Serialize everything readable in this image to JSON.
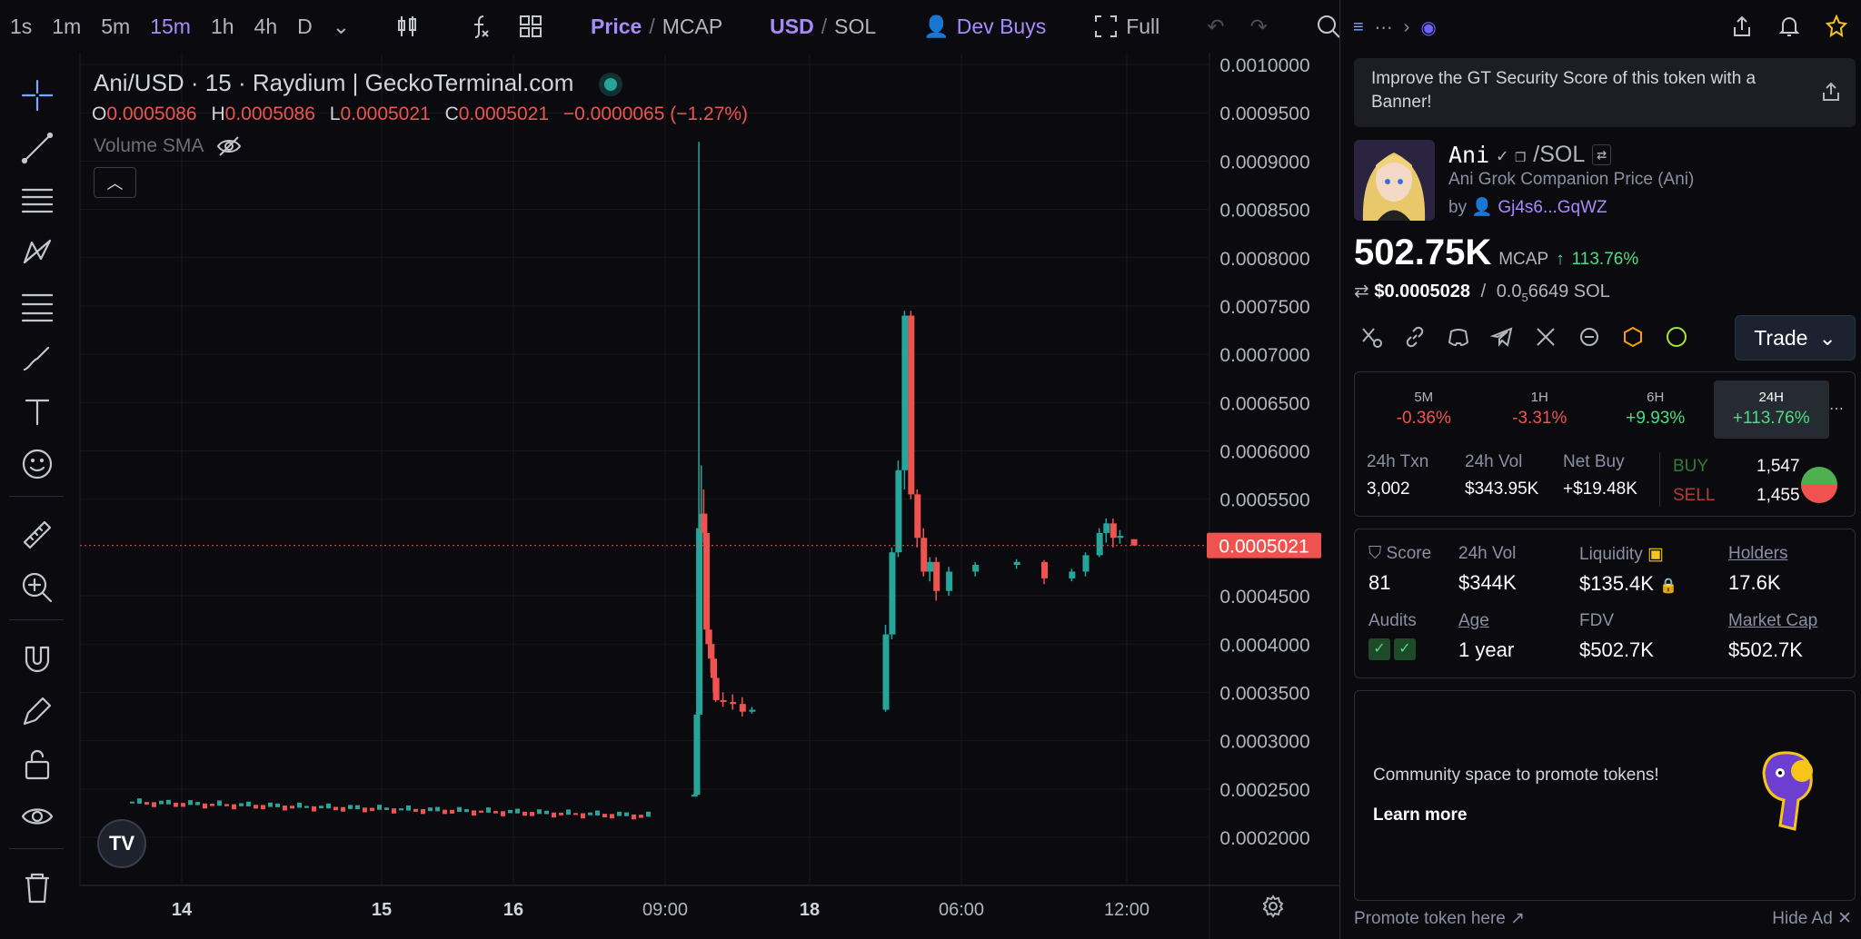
{
  "toolbar": {
    "timeframes": [
      "1s",
      "1m",
      "5m",
      "15m",
      "1h",
      "4h",
      "D"
    ],
    "active_timeframe": "15m",
    "price_label": "Price",
    "mcap_label": "MCAP",
    "usd_label": "USD",
    "sol_label": "SOL",
    "dev_buys_label": "Dev Buys",
    "full_label": "Full",
    "divider": "/"
  },
  "legend": {
    "title": "Ani/USD · 15 · Raydium | GeckoTerminal.com",
    "o_key": "O",
    "o_val": "0.0005086",
    "h_key": "H",
    "h_val": "0.0005086",
    "l_key": "L",
    "l_val": "0.0005021",
    "c_key": "C",
    "c_val": "0.0005021",
    "change": "−0.0000065 (−1.27%)",
    "volume_sma": "Volume SMA"
  },
  "chart_data": {
    "type": "candlestick",
    "title": "Ani/USD · 15 · Raydium | GeckoTerminal.com",
    "y_ticks": [
      "0.0010000",
      "0.0009500",
      "0.0009000",
      "0.0008500",
      "0.0008000",
      "0.0007500",
      "0.0007000",
      "0.0006500",
      "0.0006000",
      "0.0005500",
      "0.0005021",
      "0.0004500",
      "0.0004000",
      "0.0003500",
      "0.0003000",
      "0.0002500",
      "0.0002000"
    ],
    "x_ticks": [
      "14",
      "15",
      "16",
      "09:00",
      "18",
      "06:00",
      "12:00"
    ],
    "ylim": [
      0.00016,
      0.001
    ],
    "last_price": 0.0005021,
    "last_price_label": "0.0005021",
    "baseline_segments": [
      {
        "from": "13 18:00",
        "to": "17 08:00",
        "price_start": 0.000236,
        "price_end": 0.000222
      }
    ],
    "candles": [
      {
        "t": "17 12:00",
        "o": 0.000243,
        "h": 0.000245,
        "l": 0.000242,
        "c": 0.000244
      },
      {
        "t": "17 12:15",
        "o": 0.000244,
        "h": 0.00033,
        "l": 0.000243,
        "c": 0.000327
      },
      {
        "t": "17 12:30",
        "o": 0.000327,
        "h": 0.00092,
        "l": 0.00032,
        "c": 0.00052
      },
      {
        "t": "17 12:45",
        "o": 0.00052,
        "h": 0.000585,
        "l": 0.00048,
        "c": 0.000535
      },
      {
        "t": "17 13:00",
        "o": 0.000535,
        "h": 0.00056,
        "l": 0.000505,
        "c": 0.000515
      },
      {
        "t": "17 13:15",
        "o": 0.000515,
        "h": 0.00053,
        "l": 0.0004,
        "c": 0.000415
      },
      {
        "t": "17 13:30",
        "o": 0.000415,
        "h": 0.000425,
        "l": 0.000385,
        "c": 0.0004
      },
      {
        "t": "17 13:45",
        "o": 0.0004,
        "h": 0.000405,
        "l": 0.00037,
        "c": 0.000385
      },
      {
        "t": "17 14:00",
        "o": 0.000385,
        "h": 0.000395,
        "l": 0.00035,
        "c": 0.000365
      },
      {
        "t": "17 14:15",
        "o": 0.000365,
        "h": 0.000375,
        "l": 0.00034,
        "c": 0.000342
      },
      {
        "t": "17 15:00",
        "o": 0.000342,
        "h": 0.00035,
        "l": 0.000335,
        "c": 0.00034
      },
      {
        "t": "17 16:00",
        "o": 0.00034,
        "h": 0.000348,
        "l": 0.000332,
        "c": 0.000338
      },
      {
        "t": "17 17:00",
        "o": 0.000338,
        "h": 0.000345,
        "l": 0.000325,
        "c": 0.00033
      },
      {
        "t": "17 18:00",
        "o": 0.00033,
        "h": 0.000335,
        "l": 0.000328,
        "c": 0.000332
      },
      {
        "t": "18 03:00",
        "o": 0.000332,
        "h": 0.00042,
        "l": 0.00033,
        "c": 0.00041
      },
      {
        "t": "18 03:15",
        "o": 0.00041,
        "h": 0.0005,
        "l": 0.000405,
        "c": 0.000495
      },
      {
        "t": "18 03:30",
        "o": 0.000495,
        "h": 0.00059,
        "l": 0.00049,
        "c": 0.00058
      },
      {
        "t": "18 03:45",
        "o": 0.00058,
        "h": 0.000745,
        "l": 0.00056,
        "c": 0.00074
      },
      {
        "t": "18 04:00",
        "o": 0.00074,
        "h": 0.000745,
        "l": 0.00055,
        "c": 0.000555
      },
      {
        "t": "18 04:15",
        "o": 0.000555,
        "h": 0.00056,
        "l": 0.0005,
        "c": 0.00051
      },
      {
        "t": "18 04:30",
        "o": 0.00051,
        "h": 0.00052,
        "l": 0.00047,
        "c": 0.000475
      },
      {
        "t": "18 04:45",
        "o": 0.000475,
        "h": 0.00049,
        "l": 0.000465,
        "c": 0.000485
      },
      {
        "t": "18 05:00",
        "o": 0.000485,
        "h": 0.00049,
        "l": 0.000445,
        "c": 0.000455
      },
      {
        "t": "18 05:30",
        "o": 0.000455,
        "h": 0.00048,
        "l": 0.00045,
        "c": 0.000475
      },
      {
        "t": "18 06:30",
        "o": 0.000475,
        "h": 0.000485,
        "l": 0.00047,
        "c": 0.000482
      },
      {
        "t": "18 08:00",
        "o": 0.000482,
        "h": 0.000488,
        "l": 0.000478,
        "c": 0.000485
      },
      {
        "t": "18 09:00",
        "o": 0.000485,
        "h": 0.000487,
        "l": 0.000462,
        "c": 0.000468
      },
      {
        "t": "18 10:00",
        "o": 0.000468,
        "h": 0.000478,
        "l": 0.000465,
        "c": 0.000475
      },
      {
        "t": "18 10:30",
        "o": 0.000475,
        "h": 0.000495,
        "l": 0.00047,
        "c": 0.000492
      },
      {
        "t": "18 11:00",
        "o": 0.000492,
        "h": 0.00052,
        "l": 0.00049,
        "c": 0.000515
      },
      {
        "t": "18 11:15",
        "o": 0.000515,
        "h": 0.00053,
        "l": 0.000505,
        "c": 0.000525
      },
      {
        "t": "18 11:30",
        "o": 0.000525,
        "h": 0.00053,
        "l": 0.0005,
        "c": 0.00051
      },
      {
        "t": "18 11:45",
        "o": 0.00051,
        "h": 0.000518,
        "l": 0.000504,
        "c": 0.000512
      },
      {
        "t": "18 12:15",
        "o": 0.0005086,
        "h": 0.0005086,
        "l": 0.0005021,
        "c": 0.0005021
      }
    ],
    "up_color": "#26a69a",
    "down_color": "#ef5350",
    "grid": true
  },
  "panel": {
    "banner_text": "Improve the GT Security Score of this token with a Banner!",
    "token_symbol": "Ani",
    "pair_suffix": "/SOL",
    "token_full_name": "Ani Grok Companion Price (Ani)",
    "by_label": "by",
    "creator": "Gj4s6...GqWZ",
    "mcap_value": "502.75K",
    "mcap_label": "MCAP",
    "mcap_change": "113.76%",
    "price_usd": "$0.0005028",
    "price_sol_prefix": "0.0",
    "price_sol_sub": "5",
    "price_sol_rest": "6649 SOL",
    "price_sep": "/",
    "trade_label": "Trade",
    "periods": [
      {
        "label": "5M",
        "value": "-0.36%"
      },
      {
        "label": "1H",
        "value": "-3.31%"
      },
      {
        "label": "6H",
        "value": "+9.93%"
      },
      {
        "label": "24H",
        "value": "+113.76%"
      }
    ],
    "txn_label": "24h Txn",
    "txn_value": "3,002",
    "vol_label": "24h Vol",
    "vol_value": "$343.95K",
    "netbuy_label": "Net Buy",
    "netbuy_value": "+$19.48K",
    "buy_label": "BUY",
    "buy_value": "1,547",
    "sell_label": "SELL",
    "sell_value": "1,455",
    "score_label": "Score",
    "score_value": "81",
    "vol2_label": "24h Vol",
    "vol2_value": "$344K",
    "liq_label": "Liquidity",
    "liq_value": "$135.4K",
    "holders_label": "Holders",
    "holders_value": "17.6K",
    "audits_label": "Audits",
    "age_label": "Age",
    "age_value": "1 year",
    "fdv_label": "FDV",
    "fdv_value": "$502.7K",
    "mcap2_label": "Market Cap",
    "mcap2_value": "$502.7K",
    "ad_text": "Community space to promote tokens!",
    "ad_learn": "Learn more",
    "promote_label": "Promote token here ↗",
    "hide_ad_label": "Hide Ad ✕"
  }
}
